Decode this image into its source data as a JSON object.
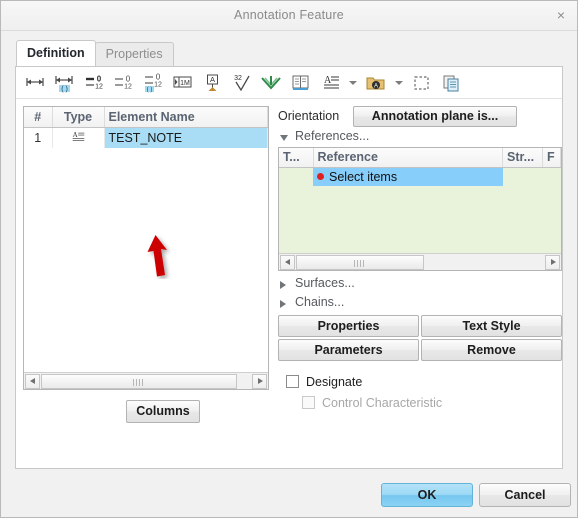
{
  "window": {
    "title": "Annotation Feature",
    "close_label": "×",
    "close_icon": "close-icon"
  },
  "tabs": [
    {
      "label": "Definition",
      "active": true
    },
    {
      "label": "Properties",
      "active": false
    }
  ],
  "toolbar": {
    "items": [
      {
        "name": "dimension-icon",
        "title": "Dimension"
      },
      {
        "name": "reference-dimension-icon",
        "title": "Reference Dimension"
      },
      {
        "name": "ordinate-dimension-icon",
        "title": "Ordinate Dimension"
      },
      {
        "name": "ordinate-reference-dim-icon",
        "title": "Ordinate Reference Dimension"
      },
      {
        "name": "ordinate-baseline-icon",
        "title": "Ordinate Baseline"
      },
      {
        "name": "driven-dimension-icon",
        "title": "Driven Dimension"
      },
      {
        "name": "datum-feature-icon",
        "title": "Set Datum"
      },
      {
        "name": "surface-finish-icon",
        "title": "Surface Finish"
      },
      {
        "name": "geometric-tolerance-icon",
        "title": "Geometric Tolerance"
      },
      {
        "name": "note-book-icon",
        "title": "Note"
      },
      {
        "name": "annotation-note-icon",
        "title": "Annotation Note"
      },
      {
        "name": "annotation-note-caret-icon",
        "title": "More note types"
      },
      {
        "name": "symbol-folder-icon",
        "title": "Symbol"
      },
      {
        "name": "symbol-caret-icon",
        "title": "More symbols"
      },
      {
        "name": "select-box-icon",
        "title": "Selection Box"
      },
      {
        "name": "copy-icon",
        "title": "Copy"
      }
    ]
  },
  "elements_table": {
    "columns": [
      "#",
      "Type",
      "Element Name"
    ],
    "rows": [
      {
        "num": "1",
        "type_icon": "annotation-note-icon",
        "name": "TEST_NOTE",
        "selected": true
      }
    ],
    "columns_button": "Columns"
  },
  "orientation": {
    "label": "Orientation",
    "plane_button": "Annotation plane is..."
  },
  "references": {
    "disclosure_label": "References...",
    "expanded": true,
    "columns": [
      "T...",
      "Reference",
      "Str...",
      "F"
    ],
    "rows": [
      {
        "reference": "Select items",
        "selected": true,
        "marker": "red-dot"
      }
    ]
  },
  "collapsed_sections": [
    {
      "label": "Surfaces...",
      "expanded": false
    },
    {
      "label": "Chains...",
      "expanded": false
    }
  ],
  "action_buttons": [
    "Properties",
    "Text Style",
    "Parameters",
    "Remove"
  ],
  "checkboxes": [
    {
      "label": "Designate",
      "checked": false,
      "enabled": true
    },
    {
      "label": "Control Characteristic",
      "checked": false,
      "enabled": false
    }
  ],
  "footer": {
    "ok_label": "OK",
    "cancel_label": "Cancel"
  },
  "callout": {
    "name": "red-arrow-annotation",
    "color": "#cc0000"
  },
  "colors": {
    "selection_blue": "#a8ddf5",
    "reference_row_blue": "#87cefa",
    "reference_panel_green": "#e9f3dc",
    "ok_button_blue": "#8dd2f4",
    "callout_red": "#cc0000"
  }
}
